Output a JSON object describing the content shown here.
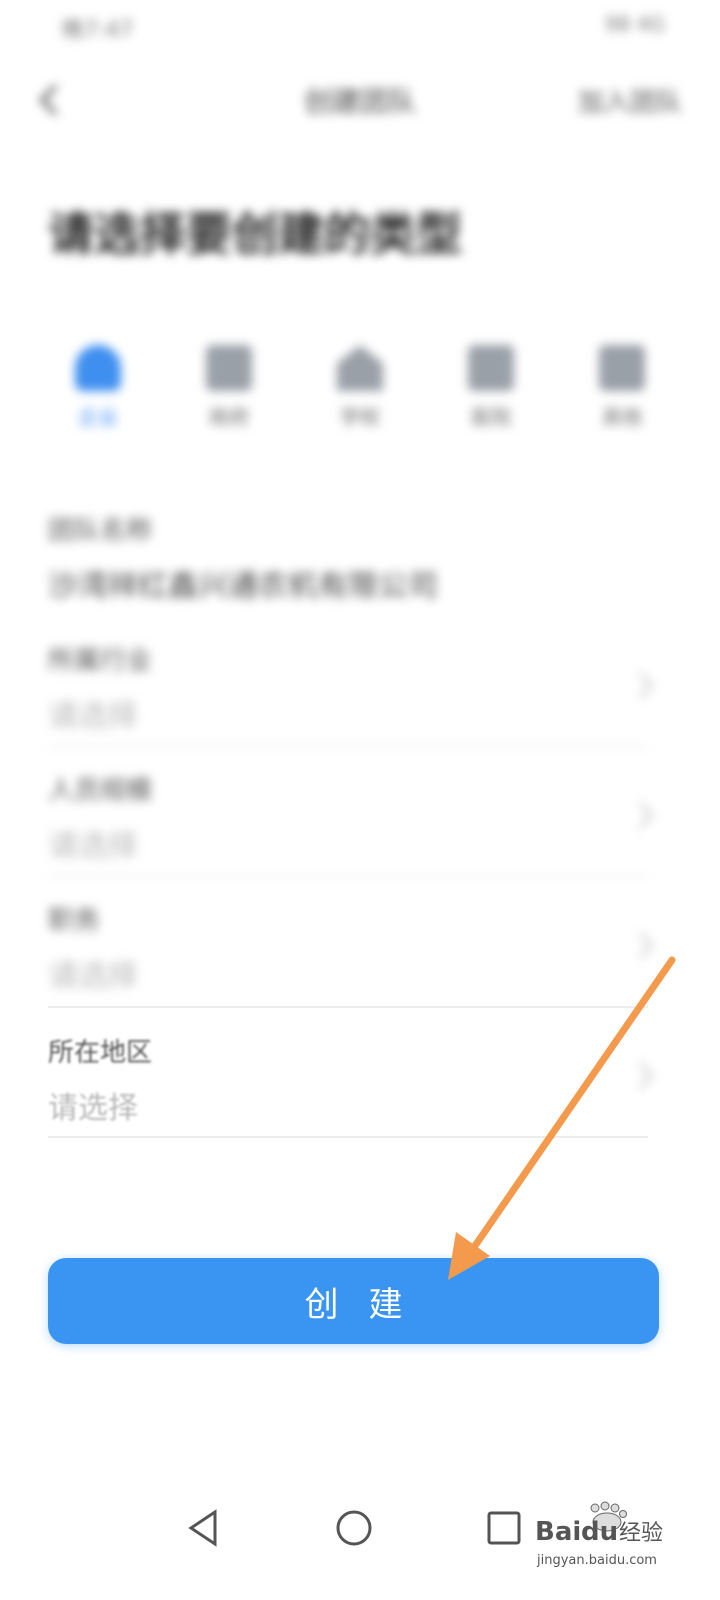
{
  "status_bar": {
    "left_text": "晚7:47",
    "right_text": "98 4G"
  },
  "nav": {
    "title": "创建团队",
    "action_label": "加入团队"
  },
  "heading": "请选择要创建的类型",
  "type_options": [
    {
      "label": "企业",
      "icon": "building-icon",
      "active": true
    },
    {
      "label": "政府",
      "icon": "building-icon",
      "active": false
    },
    {
      "label": "学校",
      "icon": "school-icon",
      "active": false
    },
    {
      "label": "医院",
      "icon": "hospital-icon",
      "active": false
    },
    {
      "label": "其他",
      "icon": "more-icon",
      "active": false
    }
  ],
  "fields": [
    {
      "label": "团队名称",
      "value": "沙湾祥红鑫兴通农机有限公司",
      "placeholder": ""
    },
    {
      "label": "所属行业",
      "value": "",
      "placeholder": "请选择"
    },
    {
      "label": "人员规模",
      "value": "",
      "placeholder": "请选择"
    },
    {
      "label": "职务",
      "value": "",
      "placeholder": "请选择"
    },
    {
      "label": "所在地区",
      "value": "",
      "placeholder": "请选择"
    }
  ],
  "create_button_label": "创建",
  "system_nav": {
    "back": "back-icon",
    "home": "home-icon",
    "recent": "recent-apps-icon"
  },
  "watermark": {
    "brand": "Baidu",
    "brand_cn": "经验",
    "url": "jingyan.baidu.com"
  },
  "colors": {
    "accent": "#3a95f2",
    "annotation_arrow": "#f39a4c"
  }
}
